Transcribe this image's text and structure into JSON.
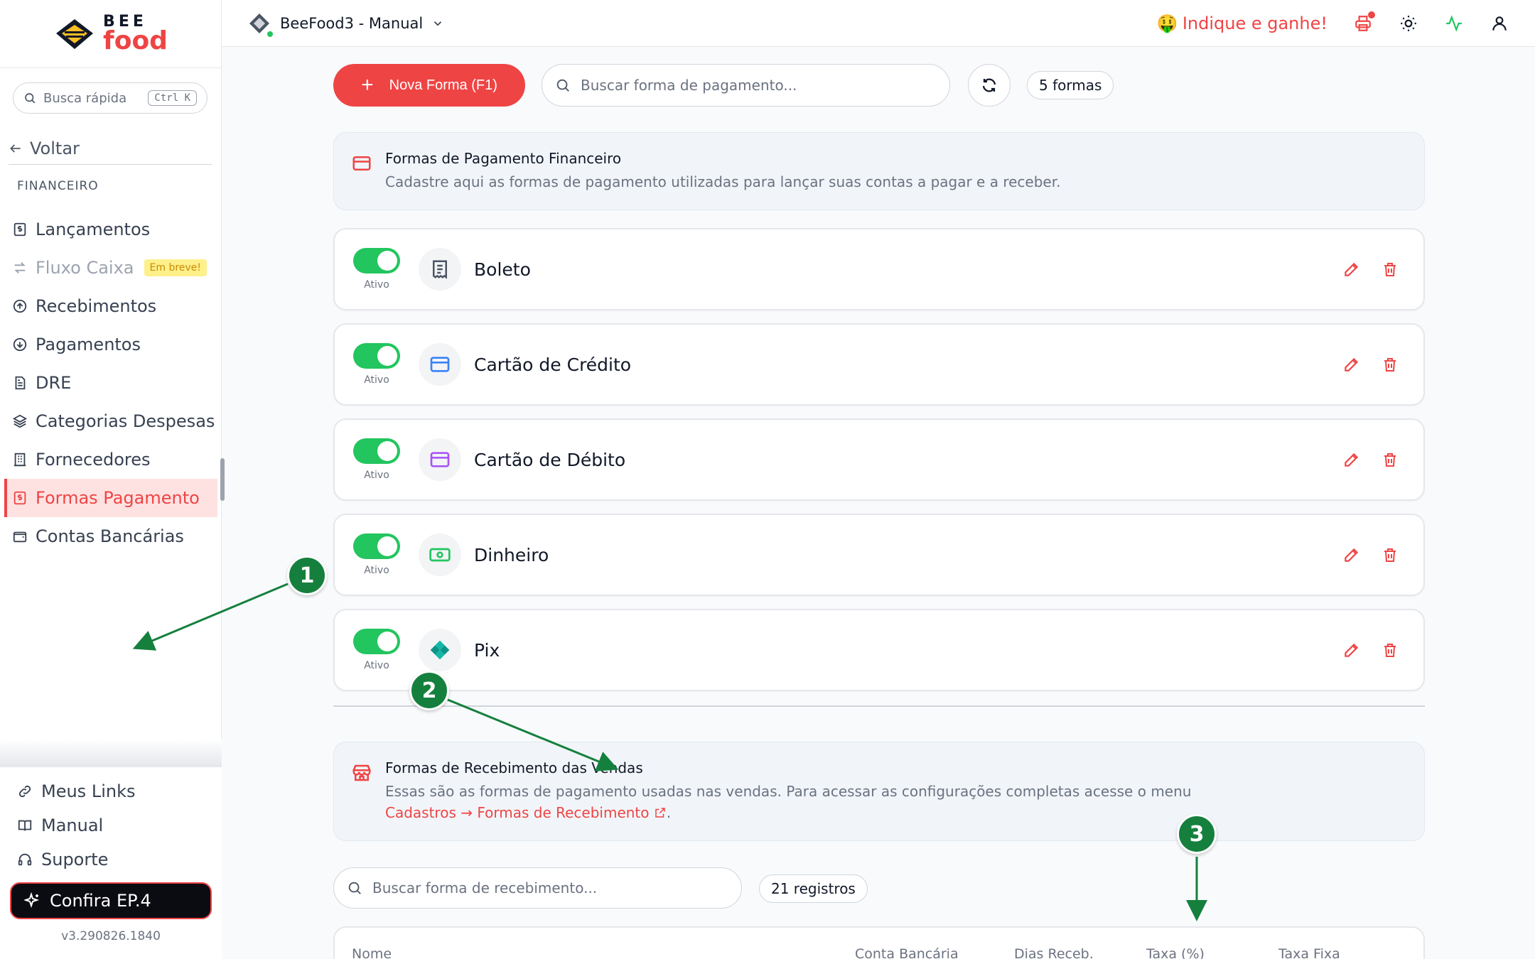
{
  "header": {
    "app_name": "BeeFood3 - Manual",
    "refer_label": "Indique e ganhe!",
    "refer_emoji": "🤑"
  },
  "sidebar": {
    "logo_top": "BEE",
    "logo_bottom": "food",
    "quick_search": "Busca rápida",
    "quick_search_kbd": "Ctrl K",
    "back_label": "Voltar",
    "section": "FINANCEIRO",
    "items": [
      {
        "label": "Lançamentos",
        "icon": "receipt-dollar-icon"
      },
      {
        "label": "Fluxo Caixa",
        "icon": "arrows-exchange-icon",
        "disabled": true,
        "badge": "Em breve!"
      },
      {
        "label": "Recebimentos",
        "icon": "arrow-up-circle-icon"
      },
      {
        "label": "Pagamentos",
        "icon": "arrow-down-circle-icon"
      },
      {
        "label": "DRE",
        "icon": "document-icon"
      },
      {
        "label": "Categorias Despesas",
        "icon": "layers-icon"
      },
      {
        "label": "Fornecedores",
        "icon": "building-icon"
      },
      {
        "label": "Formas Pagamento",
        "icon": "receipt-dollar-icon",
        "active": true
      },
      {
        "label": "Contas Bancárias",
        "icon": "wallet-icon"
      }
    ],
    "bottom_links": [
      {
        "label": "Meus Links",
        "icon": "link-icon"
      },
      {
        "label": "Manual",
        "icon": "book-icon"
      },
      {
        "label": "Suporte",
        "icon": "headset-icon"
      }
    ],
    "confira_label": "Confira EP.4",
    "version": "v3.290826.1840"
  },
  "toolbar": {
    "new_label": "Nova Forma (F1)",
    "search_placeholder": "Buscar forma de pagamento...",
    "count": "5 formas"
  },
  "info_financeiro": {
    "title": "Formas de Pagamento Financeiro",
    "desc": "Cadastre aqui as formas de pagamento utilizadas para lançar suas contas a pagar e a receber."
  },
  "payments": [
    {
      "name": "Boleto",
      "status": "Ativo",
      "icon": "receipt-icon",
      "color": "#4b5563"
    },
    {
      "name": "Cartão de Crédito",
      "status": "Ativo",
      "icon": "credit-card-icon",
      "color": "#3b82f6"
    },
    {
      "name": "Cartão de Débito",
      "status": "Ativo",
      "icon": "debit-card-icon",
      "color": "#a855f7"
    },
    {
      "name": "Dinheiro",
      "status": "Ativo",
      "icon": "cash-icon",
      "color": "#22c55e"
    },
    {
      "name": "Pix",
      "status": "Ativo",
      "icon": "pix-icon",
      "color": "#14b8a6"
    }
  ],
  "info_vendas": {
    "title": "Formas de Recebimento das Vendas",
    "desc": "Essas são as formas de pagamento usadas nas vendas. Para acessar as configurações completas acesse o menu",
    "link": "Cadastros → Formas de Recebimento",
    "suffix": "."
  },
  "receipts": {
    "search_placeholder": "Buscar forma de recebimento...",
    "count": "21 registros",
    "columns": [
      "Nome",
      "Conta Bancária",
      "Dias Receb.",
      "Taxa (%)",
      "Taxa Fixa"
    ]
  },
  "annotations": [
    "1",
    "2",
    "3"
  ],
  "colors": {
    "accent": "#ef4444",
    "success": "#22c55e",
    "annotation": "#15803d"
  }
}
